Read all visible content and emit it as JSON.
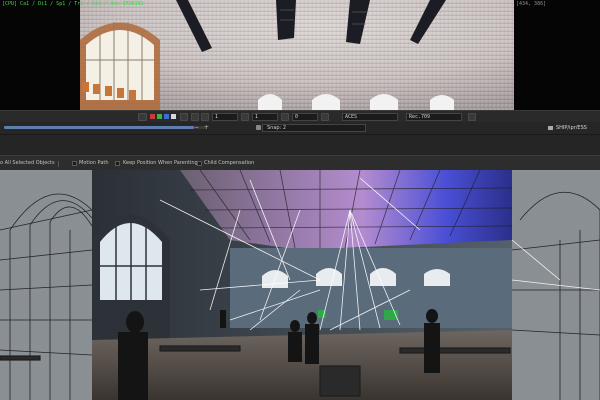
{
  "top_viewer": {
    "stats": "[CPU] Ca1 / Di1 / Sp1 / Tr1 / Sk1 / Unc-1F1E1E1",
    "resolution": "[434, 386]"
  },
  "toolbar": {
    "frame_start": "1",
    "frame_mid": "1",
    "frame_step": "0",
    "color_space": "ACES",
    "display": "Rec.709",
    "snap": "Snap: 2",
    "path": "SHIP/ipr/ESS"
  },
  "options": {
    "selected_objects": "o All Selected Objects",
    "motion_path": "Motion Path",
    "keep_position": "Keep Position When Parenting",
    "child_compensation": "Child Compensation"
  },
  "colors": {
    "hud_green": "#43d84e",
    "timeline_blue": "#5a7fb0",
    "wireframe": "#ffffff"
  }
}
